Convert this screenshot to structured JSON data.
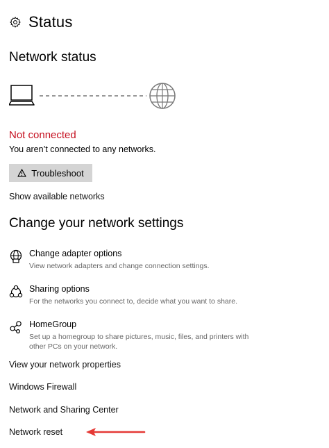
{
  "header": {
    "title": "Status",
    "icon": "gear-icon"
  },
  "network_status": {
    "heading": "Network status",
    "state": "Not connected",
    "description": "You aren’t connected to any networks.",
    "troubleshoot_label": "Troubleshoot",
    "show_networks_label": "Show available networks"
  },
  "change_settings": {
    "heading": "Change your network settings",
    "items": [
      {
        "title": "Change adapter options",
        "desc": "View network adapters and change connection settings.",
        "icon": "adapter-icon"
      },
      {
        "title": "Sharing options",
        "desc": "For the networks you connect to, decide what you want to share.",
        "icon": "sharing-icon"
      },
      {
        "title": "HomeGroup",
        "desc": "Set up a homegroup to share pictures, music, files, and printers with other PCs on your network.",
        "icon": "homegroup-icon"
      }
    ]
  },
  "links": {
    "properties": "View your network properties",
    "firewall": "Windows Firewall",
    "sharing_center": "Network and Sharing Center",
    "reset": "Network reset"
  },
  "colors": {
    "error": "#c50f1f",
    "arrow": "#e53935",
    "button_bg": "#d4d4d4"
  }
}
